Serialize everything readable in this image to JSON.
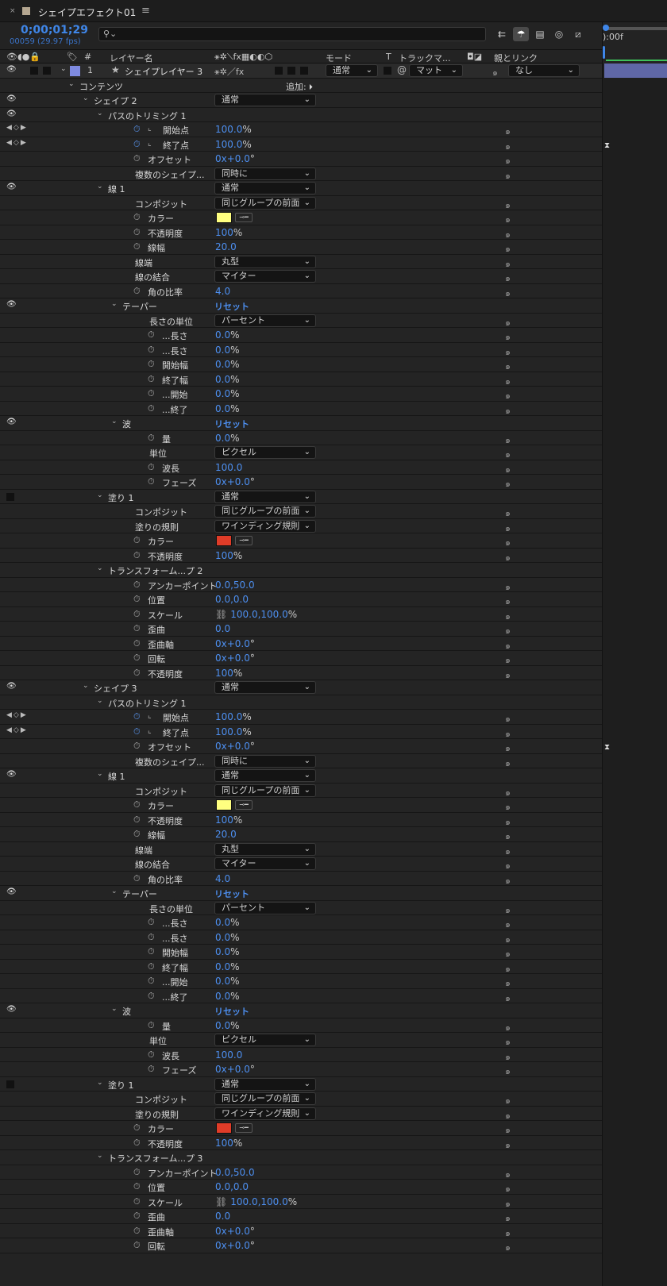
{
  "tab": {
    "close": "×",
    "name": "シェイプエフェクト01",
    "menu": "≡"
  },
  "timecode": {
    "value": "0;00;01;29",
    "frames": "00059 (29.97 fps)"
  },
  "columns": {
    "layer_name": "レイヤー名",
    "mode": "モード",
    "t": "T",
    "track_matte": "トラックマ...",
    "parent": "親とリンク",
    "hash": "#"
  },
  "timeline": {
    "ruler_label": "):00f"
  },
  "layer": {
    "number": "1",
    "name": "シェイプレイヤー 3",
    "mode": "通常",
    "matte": "マット",
    "parent": "なし",
    "color": "#7e8ae0"
  },
  "rows": [
    {
      "indent": 100,
      "tw": 1,
      "label": "コンテンツ",
      "add": "追加:"
    },
    {
      "eye": 1,
      "indent": 118,
      "tw": 1,
      "label": "シェイプ 2",
      "dd": "通常"
    },
    {
      "eye": 1,
      "indent": 136,
      "tw": 1,
      "label": "パスのトリミング 1"
    },
    {
      "kf": 1,
      "sw": "on",
      "graph": 1,
      "indent": 205,
      "label": "開始点",
      "val": "100.0",
      "unit": "%",
      "sp": 1
    },
    {
      "kf": 1,
      "sw": "on",
      "graph": 1,
      "indent": 205,
      "label": "終了点",
      "val": "100.0",
      "unit": "%",
      "sp": 1
    },
    {
      "sw": "off",
      "indent": 186,
      "label": "オフセット",
      "val": "0x+0.0",
      "unit": "°",
      "sp": 1
    },
    {
      "indent": 170,
      "label": "複数のシェイプ...",
      "dd": "同時に",
      "sp": 1
    },
    {
      "eye": 1,
      "indent": 136,
      "tw": 1,
      "label": "線 1",
      "dd": "通常"
    },
    {
      "indent": 170,
      "label": "コンポジット",
      "dd": "同じグループの前面",
      "sp": 1
    },
    {
      "sw": "off",
      "indent": 186,
      "label": "カラー",
      "color": "#ffff80",
      "sp": 1
    },
    {
      "sw": "off",
      "indent": 186,
      "label": "不透明度",
      "val": "100",
      "unit": "%",
      "sp": 1
    },
    {
      "sw": "off",
      "indent": 186,
      "label": "線幅",
      "val": "20.0",
      "sp": 1
    },
    {
      "indent": 170,
      "label": "線端",
      "dd": "丸型",
      "sp": 1
    },
    {
      "indent": 170,
      "label": "線の結合",
      "dd": "マイター",
      "sp": 1
    },
    {
      "sw": "off",
      "indent": 186,
      "label": "角の比率",
      "val": "4.0",
      "sp": 1
    },
    {
      "eye": 1,
      "indent": 154,
      "tw": 1,
      "label": "テーパー",
      "reset": "リセット"
    },
    {
      "indent": 188,
      "label": "長さの単位",
      "dd": "パーセント",
      "sp": 1
    },
    {
      "sw": "off",
      "indent": 204,
      "label": "...長さ",
      "val": "0.0",
      "unit": "%",
      "sp": 1
    },
    {
      "sw": "off",
      "indent": 204,
      "label": "...長さ",
      "val": "0.0",
      "unit": "%",
      "sp": 1
    },
    {
      "sw": "off",
      "indent": 204,
      "label": "開始幅",
      "val": "0.0",
      "unit": "%",
      "sp": 1
    },
    {
      "sw": "off",
      "indent": 204,
      "label": "終了幅",
      "val": "0.0",
      "unit": "%",
      "sp": 1
    },
    {
      "sw": "off",
      "indent": 204,
      "label": "...開始",
      "val": "0.0",
      "unit": "%",
      "sp": 1
    },
    {
      "sw": "off",
      "indent": 204,
      "label": "...終了",
      "val": "0.0",
      "unit": "%",
      "sp": 1
    },
    {
      "eye": 1,
      "indent": 154,
      "tw": 1,
      "label": "波",
      "reset": "リセット"
    },
    {
      "sw": "off",
      "indent": 204,
      "label": "量",
      "val": "0.0",
      "unit": "%",
      "sp": 1
    },
    {
      "indent": 188,
      "label": "単位",
      "dd": "ピクセル",
      "sp": 1
    },
    {
      "sw": "off",
      "indent": 204,
      "label": "波長",
      "val": "100.0",
      "sp": 1
    },
    {
      "sw": "off",
      "indent": 204,
      "label": "フェーズ",
      "val": "0x+0.0",
      "unit": "°",
      "sp": 1
    },
    {
      "sq": 1,
      "indent": 136,
      "tw": 1,
      "label": "塗り 1",
      "dd": "通常"
    },
    {
      "indent": 170,
      "label": "コンポジット",
      "dd": "同じグループの前面",
      "sp": 1
    },
    {
      "indent": 170,
      "label": "塗りの規則",
      "dd": "ワインディング規則",
      "sp": 1
    },
    {
      "sw": "off",
      "indent": 186,
      "label": "カラー",
      "color": "#e03c28",
      "sp": 1
    },
    {
      "sw": "off",
      "indent": 186,
      "label": "不透明度",
      "val": "100",
      "unit": "%",
      "sp": 1
    },
    {
      "indent": 136,
      "tw": 1,
      "label": "トランスフォーム...プ 2"
    },
    {
      "sw": "off",
      "indent": 186,
      "label": "アンカーポイント",
      "val": "0.0,50.0",
      "sp": 1
    },
    {
      "sw": "off",
      "indent": 186,
      "label": "位置",
      "val": "0.0,0.0",
      "sp": 1
    },
    {
      "sw": "off",
      "indent": 186,
      "label": "スケール",
      "val": "100.0,100.0",
      "unit": "%",
      "link": 1,
      "sp": 1
    },
    {
      "sw": "off",
      "indent": 186,
      "label": "歪曲",
      "val": "0.0",
      "sp": 1
    },
    {
      "sw": "off",
      "indent": 186,
      "label": "歪曲軸",
      "val": "0x+0.0",
      "unit": "°",
      "sp": 1
    },
    {
      "sw": "off",
      "indent": 186,
      "label": "回転",
      "val": "0x+0.0",
      "unit": "°",
      "sp": 1
    },
    {
      "sw": "off",
      "indent": 186,
      "label": "不透明度",
      "val": "100",
      "unit": "%",
      "sp": 1
    },
    {
      "eye": 1,
      "indent": 118,
      "tw": 1,
      "label": "シェイプ 3",
      "dd": "通常"
    },
    {
      "indent": 136,
      "tw": 1,
      "label": "パスのトリミング 1"
    },
    {
      "kf": 1,
      "sw": "on",
      "graph": 1,
      "indent": 205,
      "label": "開始点",
      "val": "100.0",
      "unit": "%",
      "sp": 1
    },
    {
      "kf": 1,
      "sw": "on",
      "graph": 1,
      "indent": 205,
      "label": "終了点",
      "val": "100.0",
      "unit": "%",
      "sp": 1
    },
    {
      "sw": "off",
      "indent": 186,
      "label": "オフセット",
      "val": "0x+0.0",
      "unit": "°",
      "sp": 1
    },
    {
      "indent": 170,
      "label": "複数のシェイプ...",
      "dd": "同時に",
      "sp": 1
    },
    {
      "eye": 1,
      "indent": 136,
      "tw": 1,
      "label": "線 1",
      "dd": "通常"
    },
    {
      "indent": 170,
      "label": "コンポジット",
      "dd": "同じグループの前面",
      "sp": 1
    },
    {
      "sw": "off",
      "indent": 186,
      "label": "カラー",
      "color": "#ffff80",
      "sp": 1
    },
    {
      "sw": "off",
      "indent": 186,
      "label": "不透明度",
      "val": "100",
      "unit": "%",
      "sp": 1
    },
    {
      "sw": "off",
      "indent": 186,
      "label": "線幅",
      "val": "20.0",
      "sp": 1
    },
    {
      "indent": 170,
      "label": "線端",
      "dd": "丸型",
      "sp": 1
    },
    {
      "indent": 170,
      "label": "線の結合",
      "dd": "マイター",
      "sp": 1
    },
    {
      "sw": "off",
      "indent": 186,
      "label": "角の比率",
      "val": "4.0",
      "sp": 1
    },
    {
      "eye": 1,
      "indent": 154,
      "tw": 1,
      "label": "テーパー",
      "reset": "リセット"
    },
    {
      "indent": 188,
      "label": "長さの単位",
      "dd": "パーセント",
      "sp": 1
    },
    {
      "sw": "off",
      "indent": 204,
      "label": "...長さ",
      "val": "0.0",
      "unit": "%",
      "sp": 1
    },
    {
      "sw": "off",
      "indent": 204,
      "label": "...長さ",
      "val": "0.0",
      "unit": "%",
      "sp": 1
    },
    {
      "sw": "off",
      "indent": 204,
      "label": "開始幅",
      "val": "0.0",
      "unit": "%",
      "sp": 1
    },
    {
      "sw": "off",
      "indent": 204,
      "label": "終了幅",
      "val": "0.0",
      "unit": "%",
      "sp": 1
    },
    {
      "sw": "off",
      "indent": 204,
      "label": "...開始",
      "val": "0.0",
      "unit": "%",
      "sp": 1
    },
    {
      "sw": "off",
      "indent": 204,
      "label": "...終了",
      "val": "0.0",
      "unit": "%",
      "sp": 1
    },
    {
      "eye": 1,
      "indent": 154,
      "tw": 1,
      "label": "波",
      "reset": "リセット"
    },
    {
      "sw": "off",
      "indent": 204,
      "label": "量",
      "val": "0.0",
      "unit": "%",
      "sp": 1
    },
    {
      "indent": 188,
      "label": "単位",
      "dd": "ピクセル",
      "sp": 1
    },
    {
      "sw": "off",
      "indent": 204,
      "label": "波長",
      "val": "100.0",
      "sp": 1
    },
    {
      "sw": "off",
      "indent": 204,
      "label": "フェーズ",
      "val": "0x+0.0",
      "unit": "°",
      "sp": 1
    },
    {
      "sq": 1,
      "indent": 136,
      "tw": 1,
      "label": "塗り 1",
      "dd": "通常"
    },
    {
      "indent": 170,
      "label": "コンポジット",
      "dd": "同じグループの前面",
      "sp": 1
    },
    {
      "indent": 170,
      "label": "塗りの規則",
      "dd": "ワインディング規則",
      "sp": 1
    },
    {
      "sw": "off",
      "indent": 186,
      "label": "カラー",
      "color": "#e03c28",
      "sp": 1
    },
    {
      "sw": "off",
      "indent": 186,
      "label": "不透明度",
      "val": "100",
      "unit": "%",
      "sp": 1
    },
    {
      "indent": 136,
      "tw": 1,
      "label": "トランスフォーム...プ 3"
    },
    {
      "sw": "off",
      "indent": 186,
      "label": "アンカーポイント",
      "val": "0.0,50.0",
      "sp": 1
    },
    {
      "sw": "off",
      "indent": 186,
      "label": "位置",
      "val": "0.0,0.0",
      "sp": 1
    },
    {
      "sw": "off",
      "indent": 186,
      "label": "スケール",
      "val": "100.0,100.0",
      "unit": "%",
      "link": 1,
      "sp": 1
    },
    {
      "sw": "off",
      "indent": 186,
      "label": "歪曲",
      "val": "0.0",
      "sp": 1
    },
    {
      "sw": "off",
      "indent": 186,
      "label": "歪曲軸",
      "val": "0x+0.0",
      "unit": "°",
      "sp": 1
    },
    {
      "sw": "off",
      "indent": 186,
      "label": "回転",
      "val": "0x+0.0",
      "unit": "°",
      "sp": 1
    }
  ]
}
